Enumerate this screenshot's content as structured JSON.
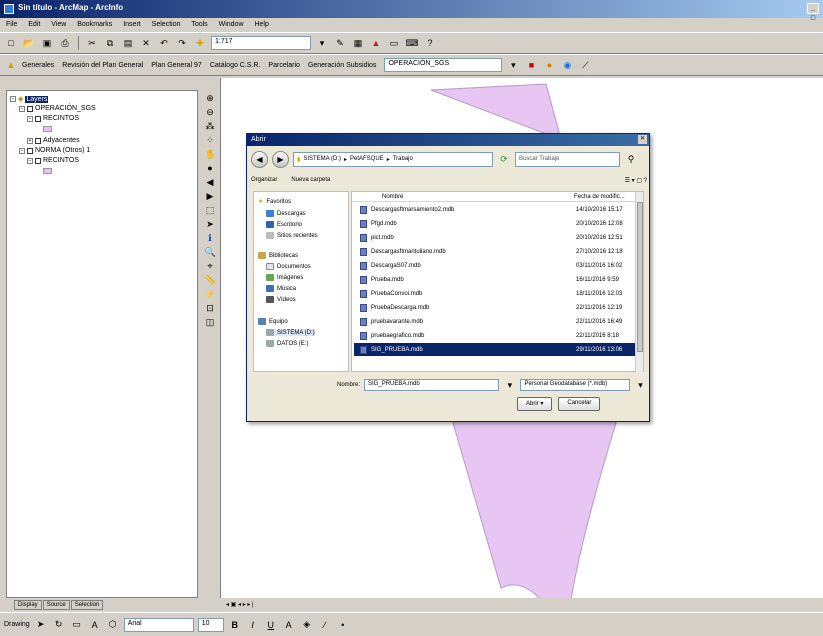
{
  "window": {
    "title": "Sin título - ArcMap - ArcInfo"
  },
  "menu": [
    "File",
    "Edit",
    "View",
    "Bookmarks",
    "Insert",
    "Selection",
    "Tools",
    "Window",
    "Help"
  ],
  "toolbar": {
    "scale": "1:717"
  },
  "toolbar2": {
    "items": [
      "Generales",
      "Revisión del Plan General",
      "Plan General 97",
      "Catálogo C.S.R.",
      "Parcelario",
      "Generación Subsidios"
    ],
    "layer_combo": "OPERACIÓN_SGS"
  },
  "toc": {
    "root": "Layers",
    "items": [
      "OPERACIÓN_SGS",
      "RECINTOS",
      "Adyacentes",
      "NORMA (Otros) 1",
      "RECINTOS"
    ],
    "tabs": [
      "Display",
      "Source",
      "Selection"
    ]
  },
  "dialog": {
    "title": "Abrir",
    "breadcrumb": [
      "SISTEMA (D:)",
      "PetAFSQUE",
      "Trabajo"
    ],
    "search_placeholder": "Buscar Trabajo",
    "organize": "Organizar",
    "new_folder": "Nueva carpeta",
    "nav": {
      "favorites": "Favoritos",
      "fav_items": [
        "Descargas",
        "Escritorio",
        "Sitios recientes"
      ],
      "libraries": "Bibliotecas",
      "lib_items": [
        "Documentos",
        "Imágenes",
        "Música",
        "Vídeos"
      ],
      "computer": "Equipo",
      "computer_items": [
        "SISTEMA (D:)",
        "DATOS (E:)"
      ]
    },
    "columns": {
      "name": "Nombre",
      "date": "Fecha de modific..."
    },
    "files": [
      {
        "name": "Descargasftmarsamiento2.mdb",
        "date": "14/10/2016 15:17"
      },
      {
        "name": "Pfgd.mdb",
        "date": "20/10/2016 12:08"
      },
      {
        "name": "pict.mdb",
        "date": "20/10/2016 12:51"
      },
      {
        "name": "Descargasftmantuliano.mdb",
        "date": "27/10/2016 12:18"
      },
      {
        "name": "DescargaS07.mdb",
        "date": "03/11/2016 16:02"
      },
      {
        "name": "Prueba.mdb",
        "date": "16/11/2016 9:59"
      },
      {
        "name": "PruebaConvoi.mdb",
        "date": "18/11/2016 12:03"
      },
      {
        "name": "PruebaDescarga.mdb",
        "date": "22/11/2016 12:19"
      },
      {
        "name": "pruebavarante.mdb",
        "date": "22/11/2016 16:49"
      },
      {
        "name": "pruebaegrafico.mdb",
        "date": "22/11/2016 8:18"
      },
      {
        "name": "SIG_PRUEBA.mdb",
        "date": "29/11/2016 13:06"
      }
    ],
    "filename_label": "Nombre:",
    "filename_value": "SIG_PRUEBA.mdb",
    "filetype": "Personal Geodatabase (*.mdb)",
    "open_btn": "Abrir",
    "cancel_btn": "Cancelar"
  },
  "drawing": {
    "label": "Drawing",
    "font": "Arial",
    "size": "10"
  }
}
